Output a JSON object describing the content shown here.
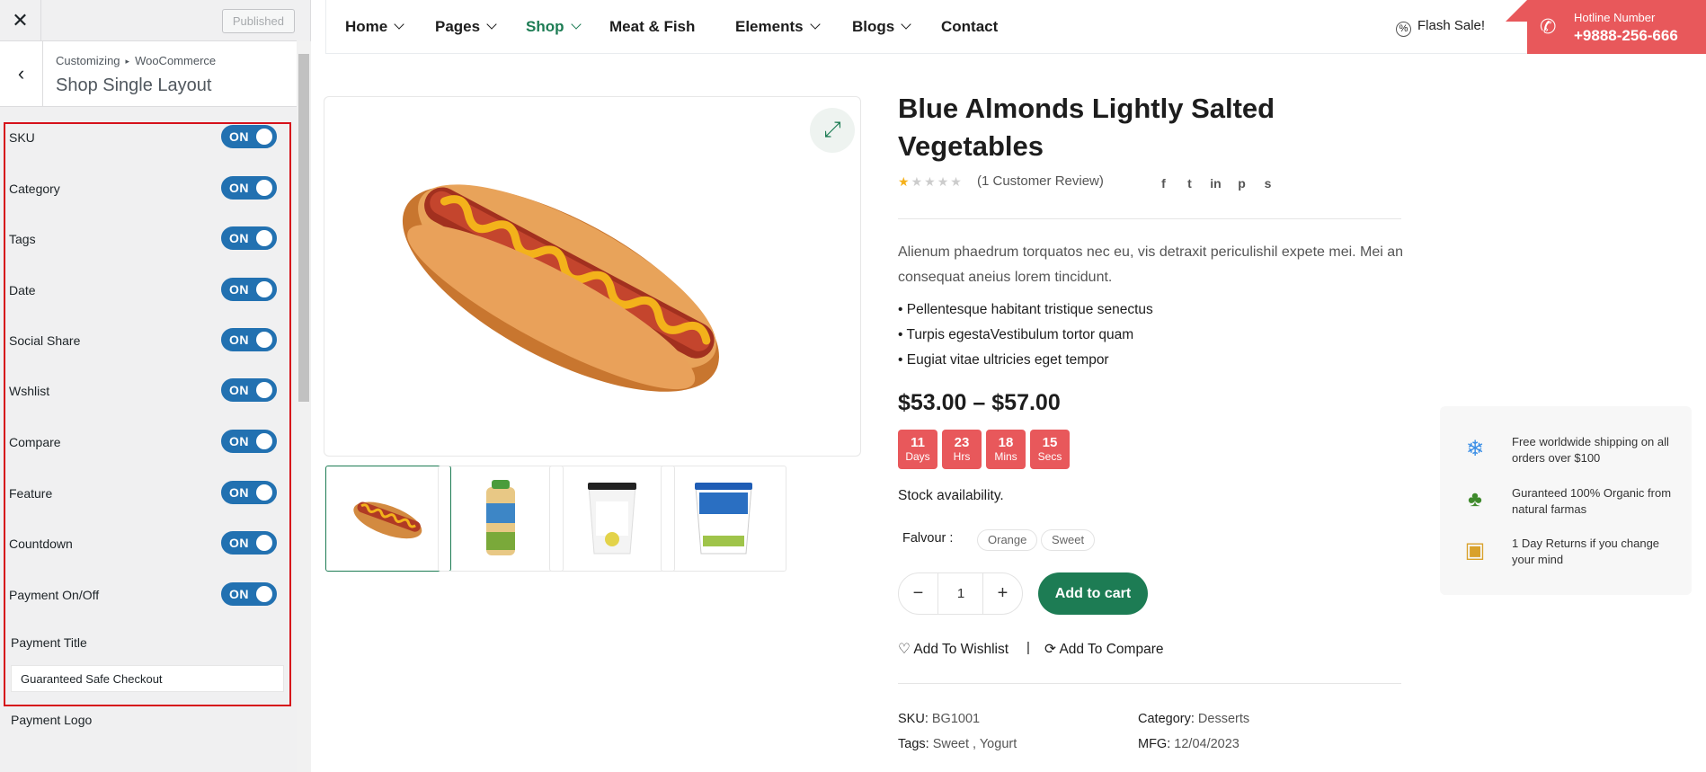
{
  "customizer": {
    "close_icon": "close-icon",
    "published_label": "Published",
    "breadcrumb_root": "Customizing",
    "breadcrumb_sep": "▸",
    "breadcrumb_section": "WooCommerce",
    "section_title": "Shop Single Layout",
    "options": [
      {
        "label": "SKU",
        "state": "ON"
      },
      {
        "label": "Category",
        "state": "ON"
      },
      {
        "label": "Tags",
        "state": "ON"
      },
      {
        "label": "Date",
        "state": "ON"
      },
      {
        "label": "Social Share",
        "state": "ON"
      },
      {
        "label": "Wshlist",
        "state": "ON"
      },
      {
        "label": "Compare",
        "state": "ON"
      },
      {
        "label": "Feature",
        "state": "ON"
      },
      {
        "label": "Countdown",
        "state": "ON"
      },
      {
        "label": "Payment On/Off",
        "state": "ON"
      }
    ],
    "payment_title_label": "Payment Title",
    "payment_title_value": "Guaranteed Safe Checkout",
    "payment_logo_label": "Payment Logo"
  },
  "nav": {
    "items": [
      {
        "label": "Home",
        "dropdown": true
      },
      {
        "label": "Pages",
        "dropdown": true
      },
      {
        "label": "Shop",
        "dropdown": true,
        "active": true
      },
      {
        "label": "Meat & Fish",
        "dropdown": false
      },
      {
        "label": "Elements",
        "dropdown": true
      },
      {
        "label": "Blogs",
        "dropdown": true
      },
      {
        "label": "Contact",
        "dropdown": false
      }
    ],
    "flash_sale": "Flash Sale!",
    "hotline_label": "Hotline Number",
    "hotline_number": "+9888-256-666"
  },
  "product": {
    "title": "Blue Almonds Lightly Salted Vegetables",
    "rating": 1,
    "review_text": "(1 Customer Review)",
    "social": [
      "f",
      "t",
      "in",
      "p",
      "s"
    ],
    "description": "Alienum phaedrum torquatos nec eu, vis detraxit periculishil expete mei. Mei an consequat aneius lorem tincidunt.",
    "bullets": [
      "Pellentesque habitant tristique senectus",
      "Turpis egestaVestibulum tortor quam",
      "Eugiat vitae ultricies eget tempor"
    ],
    "price": "$53.00 – $57.00",
    "countdown": [
      {
        "value": "11",
        "unit": "Days"
      },
      {
        "value": "23",
        "unit": "Hrs"
      },
      {
        "value": "18",
        "unit": "Mins"
      },
      {
        "value": "15",
        "unit": "Secs"
      }
    ],
    "stock": "Stock availability.",
    "flavour_label": "Falvour :",
    "flavours": [
      "Orange",
      "Sweet"
    ],
    "quantity": "1",
    "add_to_cart": "Add to cart",
    "wishlist": "Add To Wishlist",
    "separator": "|",
    "compare": "Add To Compare",
    "sku_label": "SKU:",
    "sku_value": "BG1001",
    "category_label": "Category:",
    "category_value": "Desserts",
    "tags_label": "Tags:",
    "tags_value_1": "Sweet",
    "tags_value_2": "Yogurt",
    "mfg_label": "MFG:",
    "mfg_value": "12/04/2023"
  },
  "features": [
    {
      "icon": "snowflake-icon",
      "text": "Free worldwide shipping on all orders over $100"
    },
    {
      "icon": "broccoli-icon",
      "text": "Guranteed 100% Organic from natural farmas"
    },
    {
      "icon": "gift-box-icon",
      "text": "1 Day Returns if you change your mind"
    }
  ],
  "colors": {
    "accent_green": "#1d7c54",
    "accent_red": "#e8585b",
    "toggle_blue": "#2271b1",
    "highlight_border": "#d6111b"
  }
}
